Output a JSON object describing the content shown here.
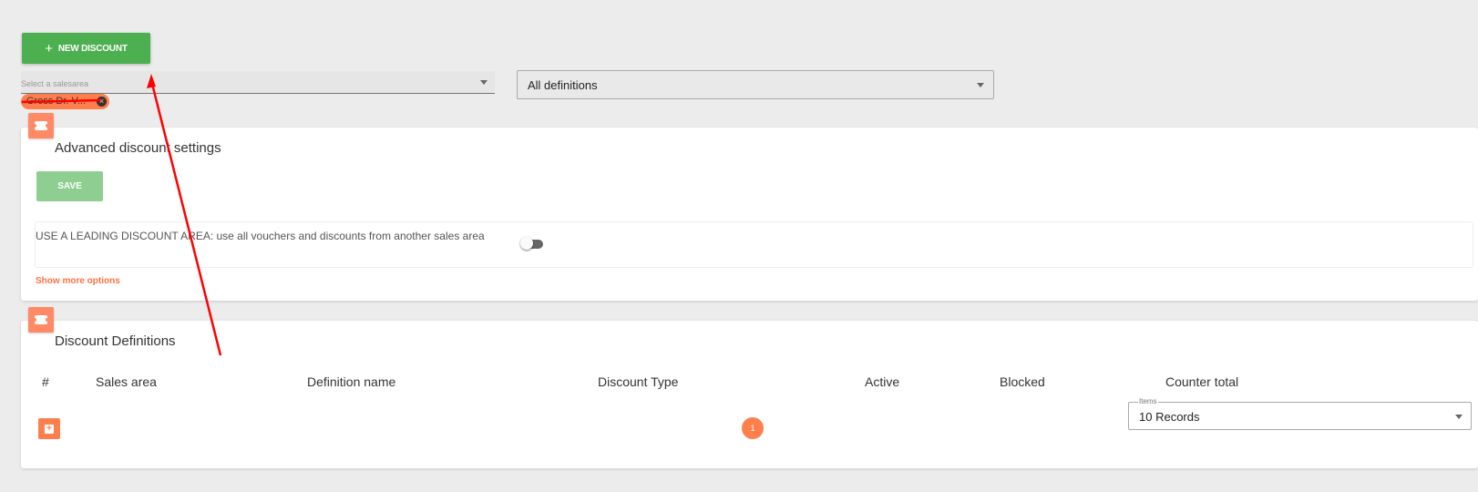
{
  "toolbar": {
    "new_discount_label": "NEW DISCOUNT"
  },
  "filters": {
    "salesarea_placeholder": "Select a salesarea",
    "salesarea_chip_label": "Gross Dr. V...",
    "definitions_value": "All definitions"
  },
  "advanced_settings": {
    "title": "Advanced discount settings",
    "save_label": "SAVE",
    "leading_area_text": "USE A LEADING DISCOUNT AREA: use all vouchers and discounts from another sales area",
    "leading_area_enabled": false,
    "show_more_label": "Show more options"
  },
  "definitions_table": {
    "title": "Discount Definitions",
    "columns": [
      "#",
      "Sales area",
      "Definition name",
      "Discount Type",
      "Active",
      "Blocked",
      "Counter total"
    ],
    "current_page": "1",
    "items_label": "Items",
    "items_value": "10 Records"
  },
  "colors": {
    "primary_green": "#4caf50",
    "accent_orange": "#ff7f4c",
    "annotation_red": "#ff0000"
  }
}
